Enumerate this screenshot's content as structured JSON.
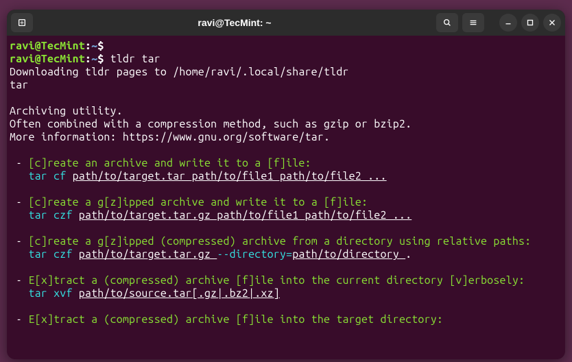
{
  "titlebar": {
    "title": "ravi@TecMint: ~"
  },
  "prompt": {
    "user": "ravi@TecMint",
    "sep": ":",
    "path": "~",
    "dollar": "$"
  },
  "lines": {
    "cmd1": " ",
    "cmd2": " tldr tar",
    "l3": "Downloading tldr pages to /home/ravi/.local/share/tldr",
    "l4": "tar",
    "l5": "",
    "l6": "Archiving utility.",
    "l7": "Often combined with a compression method, such as gzip or bzip2.",
    "l8": "More information: https://www.gnu.org/software/tar.",
    "l9": "",
    "b1d": " - ",
    "b1t": "[c]reate an archive and write it to a [f]ile:",
    "b1c_pre": "   ",
    "b1c_cmd": "tar cf ",
    "b1c_arg": "path/to/target.tar path/to/file1 path/to/file2 ...",
    "l12": "",
    "b2d": " - ",
    "b2t": "[c]reate a g[z]ipped archive and write it to a [f]ile:",
    "b2c_pre": "   ",
    "b2c_cmd": "tar czf ",
    "b2c_arg": "path/to/target.tar.gz path/to/file1 path/to/file2 ...",
    "l15": "",
    "b3d": " - ",
    "b3t": "[c]reate a g[z]ipped (compressed) archive from a directory using relative paths:",
    "b3c_pre": "   ",
    "b3c_cmd": "tar czf ",
    "b3c_arg1": "path/to/target.tar.gz ",
    "b3c_flag": "--directory=",
    "b3c_arg2": "path/to/directory ",
    "b3c_dot": ".",
    "l18": "",
    "b4d": " - ",
    "b4t": "E[x]tract a (compressed) archive [f]ile into the current directory [v]erbosely:",
    "b4c_pre": "   ",
    "b4c_cmd": "tar xvf ",
    "b4c_arg": "path/to/source.tar[.gz|.bz2|.xz]",
    "l21": "",
    "b5d": " - ",
    "b5t": "E[x]tract a (compressed) archive [f]ile into the target directory:"
  }
}
